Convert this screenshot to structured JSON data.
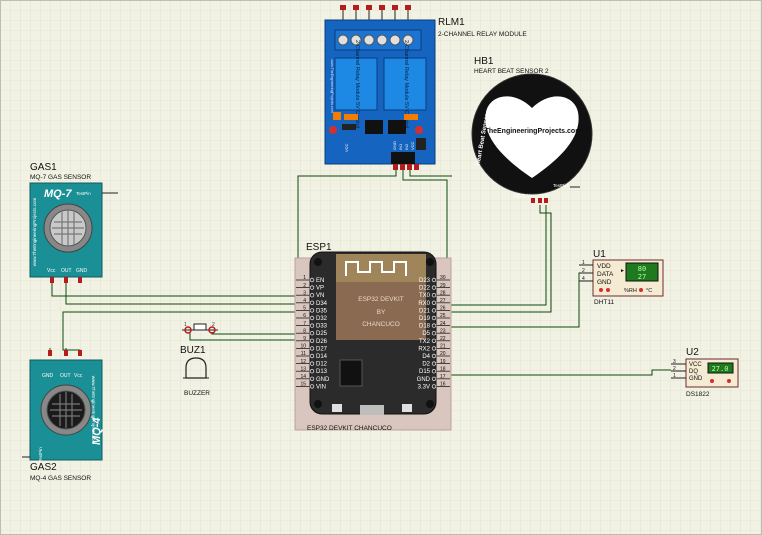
{
  "relay": {
    "ref": "RLM1",
    "name": "2-CHANNEL RELAY MODULE",
    "label1": "2-Channel Relay Module 5V Control",
    "label2": "2-Channel Relay Module 5V Control",
    "site": "www.TheEngineeringProjects.com",
    "pin_vcc": "VCC",
    "pin_gnd": "GND",
    "pin_in1": "IN1",
    "pin_in2": "IN2",
    "pin_vcc2": "VCC"
  },
  "heartbeat": {
    "ref": "HB1",
    "name": "HEART BEAT SENSOR 2",
    "brand": "TheEngineeringProjects.com",
    "side": "Heart Beat Sensor",
    "pin_gnd": "GND",
    "pin_vcc": "Vcc",
    "pin_out": "OUT",
    "test": "TestPin"
  },
  "mq7": {
    "ref": "GAS1",
    "name": "MQ-7 GAS SENSOR",
    "title": "MQ-7",
    "test": "TestPin",
    "side": "www.TheEngineeringProjects.com",
    "pins": [
      "Vcc",
      "OUT",
      "GND"
    ]
  },
  "mq4": {
    "ref": "GAS2",
    "name": "MQ-4 GAS SENSOR",
    "title": "MQ-4",
    "test": "TestPin",
    "side": "www.TheEngineeringProjects.com",
    "pins": [
      "GND",
      "OUT",
      "Vcc"
    ]
  },
  "esp": {
    "ref": "ESP1",
    "name": "ESP32 DEVKIT CHANCUCO",
    "chip1": "ESP32 DEVKIT",
    "chip2": "BY",
    "chip3": "CHANCUCO",
    "left_pins": [
      {
        "num": "1",
        "name": "EN"
      },
      {
        "num": "2",
        "name": "VP"
      },
      {
        "num": "3",
        "name": "VN"
      },
      {
        "num": "4",
        "name": "D34"
      },
      {
        "num": "5",
        "name": "D35"
      },
      {
        "num": "6",
        "name": "D32"
      },
      {
        "num": "7",
        "name": "D33"
      },
      {
        "num": "8",
        "name": "D25"
      },
      {
        "num": "9",
        "name": "D26"
      },
      {
        "num": "10",
        "name": "D27"
      },
      {
        "num": "11",
        "name": "D14"
      },
      {
        "num": "12",
        "name": "D12"
      },
      {
        "num": "13",
        "name": "D13"
      },
      {
        "num": "14",
        "name": "GND"
      },
      {
        "num": "15",
        "name": "VIN"
      }
    ],
    "right_pins": [
      {
        "num": "30",
        "name": "D23"
      },
      {
        "num": "29",
        "name": "D22"
      },
      {
        "num": "28",
        "name": "TX0"
      },
      {
        "num": "27",
        "name": "RX0"
      },
      {
        "num": "26",
        "name": "D21"
      },
      {
        "num": "25",
        "name": "D19"
      },
      {
        "num": "24",
        "name": "D18"
      },
      {
        "num": "23",
        "name": "D5"
      },
      {
        "num": "22",
        "name": "TX2"
      },
      {
        "num": "21",
        "name": "RX2"
      },
      {
        "num": "20",
        "name": "D4"
      },
      {
        "num": "19",
        "name": "D2"
      },
      {
        "num": "18",
        "name": "D15"
      },
      {
        "num": "17",
        "name": "GND"
      },
      {
        "num": "16",
        "name": "3.3V"
      }
    ]
  },
  "buzzer": {
    "ref": "BUZ1",
    "name": "BUZZER",
    "pin1": "1",
    "pin2": "2"
  },
  "dht11": {
    "ref": "U1",
    "name": "DHT11",
    "pins": [
      {
        "num": "1",
        "name": "VDD"
      },
      {
        "num": "2",
        "name": "DATA"
      },
      {
        "num": "4",
        "name": "GND"
      }
    ],
    "temp": "80",
    "hum": "27",
    "rh_label": "%RH",
    "c_label": "°C"
  },
  "ds1822": {
    "ref": "U2",
    "name": "DS1822",
    "pins": [
      {
        "num": "3",
        "name": "VCC"
      },
      {
        "num": "2",
        "name": "DQ"
      },
      {
        "num": "1",
        "name": "GND"
      }
    ],
    "reading": "27.0"
  },
  "colors": {
    "background": "#f2f2e4",
    "wire": "#0b4a0b",
    "relay_blue": "#1565c0",
    "sensor_teal": "#1a8f95",
    "pin_red": "#b71c1c",
    "lcd_green": "#4caf50"
  }
}
